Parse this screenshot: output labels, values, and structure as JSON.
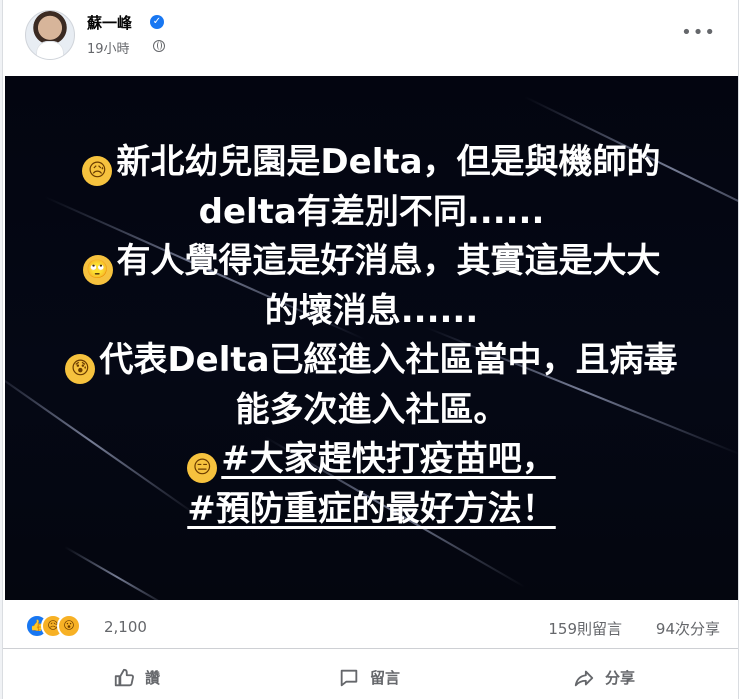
{
  "post": {
    "author": "蘇一峰",
    "time": "19小時",
    "lines": [
      {
        "emoji": "😥",
        "text": "新北幼兒園是Delta，但是與機師的"
      },
      {
        "emoji": "",
        "text": "delta有差別不同......"
      },
      {
        "emoji": "🙄",
        "text": "有人覺得這是好消息，其實這是大大"
      },
      {
        "emoji": "",
        "text": "的壞消息......"
      },
      {
        "emoji": "😰",
        "text": "代表Delta已經進入社區當中，且病毒"
      },
      {
        "emoji": "",
        "text": "能多次進入社區。"
      },
      {
        "emoji": "😑",
        "text": "#大家趕快打疫苗吧，"
      },
      {
        "emoji": "",
        "text": "#預防重症的最好方法！"
      }
    ],
    "hashtag_punct_1": "，",
    "hashtag_punct_2": "！"
  },
  "stats": {
    "reactions": "2,100",
    "comments": "159則留言",
    "shares": "94次分享"
  },
  "actions": {
    "like": "讚",
    "comment": "留言",
    "share": "分享"
  }
}
